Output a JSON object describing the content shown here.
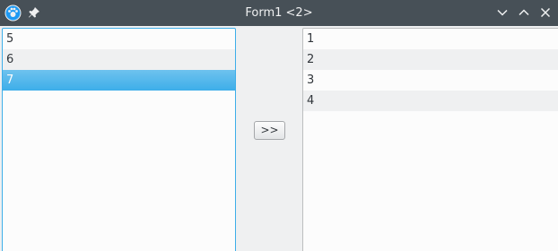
{
  "window": {
    "title": "Form1 <2>"
  },
  "left_list": {
    "items": [
      {
        "label": "5",
        "selected": false
      },
      {
        "label": "6",
        "selected": false
      },
      {
        "label": "7",
        "selected": true
      }
    ]
  },
  "move_button": {
    "label": ">>"
  },
  "right_list": {
    "items": [
      {
        "label": "1"
      },
      {
        "label": "2"
      },
      {
        "label": "3"
      },
      {
        "label": "4"
      }
    ]
  },
  "colors": {
    "titlebar": "#475057",
    "selection": "#3daee9",
    "background": "#eff0f1"
  }
}
